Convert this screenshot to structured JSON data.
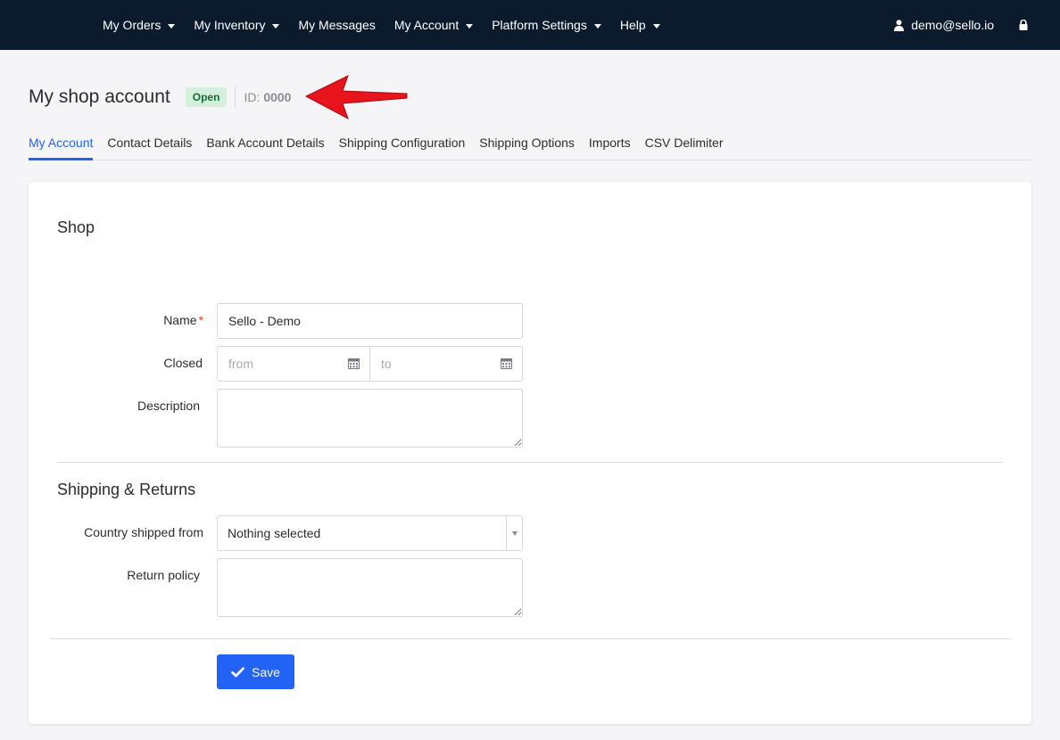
{
  "nav": {
    "items": [
      {
        "label": "My Orders",
        "dropdown": true
      },
      {
        "label": "My Inventory",
        "dropdown": true
      },
      {
        "label": "My Messages",
        "dropdown": false
      },
      {
        "label": "My Account",
        "dropdown": true
      },
      {
        "label": "Platform Settings",
        "dropdown": true
      },
      {
        "label": "Help",
        "dropdown": true
      }
    ],
    "user_email": "demo@sello.io",
    "user_icon": "user-icon",
    "lock_icon": "lock-icon",
    "bg_color": "#0c1a2e"
  },
  "header": {
    "title": "My shop account",
    "status_badge": "Open",
    "id_label": "ID:",
    "id_value": "0000"
  },
  "tabs": [
    {
      "label": "My Account",
      "active": true
    },
    {
      "label": "Contact Details",
      "active": false
    },
    {
      "label": "Bank Account Details",
      "active": false
    },
    {
      "label": "Shipping Configuration",
      "active": false
    },
    {
      "label": "Shipping Options",
      "active": false
    },
    {
      "label": "Imports",
      "active": false
    },
    {
      "label": "CSV Delimiter",
      "active": false
    }
  ],
  "shop_section": {
    "title": "Shop",
    "name_label": "Name",
    "name_required_mark": "*",
    "name_value": "Sello - Demo",
    "closed_label": "Closed",
    "closed_from_placeholder": "from",
    "closed_to_placeholder": "to",
    "description_label": "Description",
    "description_value": ""
  },
  "shipping_section": {
    "title": "Shipping & Returns",
    "country_label": "Country shipped from",
    "country_value": "Nothing selected",
    "return_policy_label": "Return policy",
    "return_policy_value": ""
  },
  "actions": {
    "save_label": "Save"
  },
  "colors": {
    "accent": "#2262f5",
    "badge_bg": "#d4f0dc",
    "badge_text": "#1b6b38",
    "arrow": "#e8141c",
    "required": "#e53935"
  }
}
